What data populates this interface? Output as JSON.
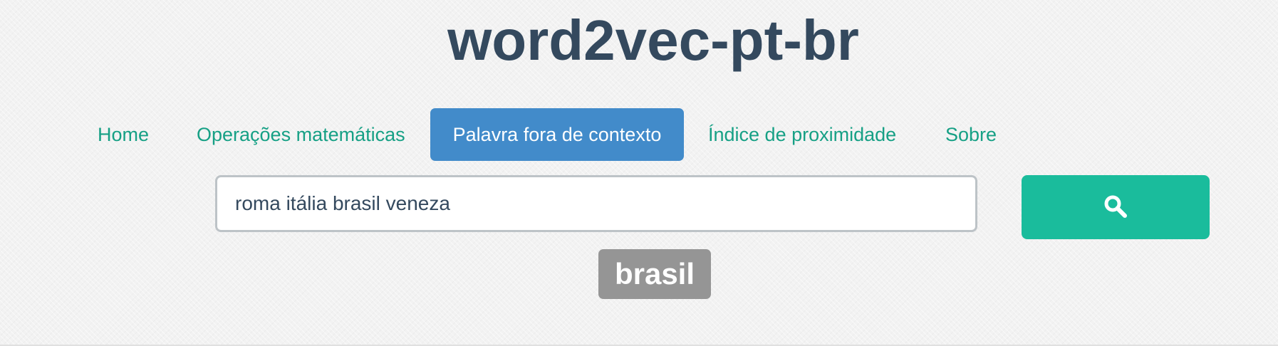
{
  "header": {
    "title": "word2vec-pt-br"
  },
  "nav": {
    "items": [
      {
        "label": "Home",
        "active": false
      },
      {
        "label": "Operações matemáticas",
        "active": false
      },
      {
        "label": "Palavra fora de contexto",
        "active": true
      },
      {
        "label": "Índice de proximidade",
        "active": false
      },
      {
        "label": "Sobre",
        "active": false
      }
    ]
  },
  "search": {
    "value": "roma itália brasil veneza",
    "button_icon": "search-icon"
  },
  "result": {
    "word": "brasil"
  },
  "colors": {
    "title": "#34495e",
    "nav_link": "#16a085",
    "nav_active_bg": "#428bca",
    "search_button_bg": "#1abc9c",
    "result_badge_bg": "#959595"
  }
}
